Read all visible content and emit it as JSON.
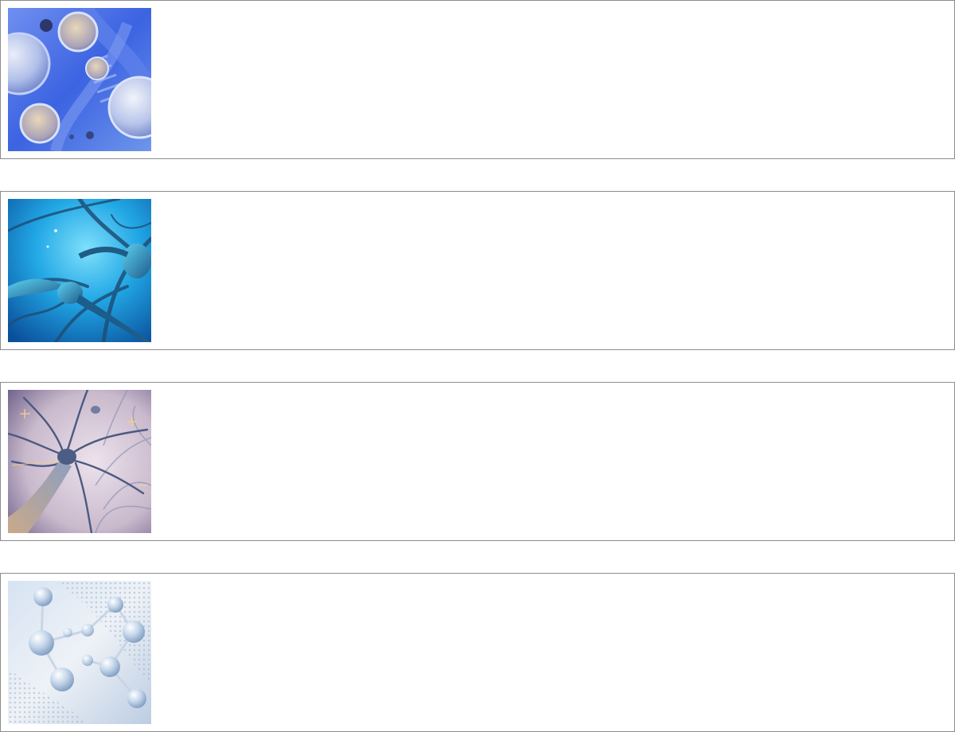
{
  "cards": [
    {
      "thumbnail": "stem-cells-dna-image",
      "accent": "#3f6ee0"
    },
    {
      "thumbnail": "neurons-blue-image",
      "accent": "#1f8fd6"
    },
    {
      "thumbnail": "neuron-network-image",
      "accent": "#8a7fb0"
    },
    {
      "thumbnail": "molecule-structure-image",
      "accent": "#a9c3de"
    }
  ],
  "colors": {
    "card_border": "#8c8c8c",
    "background": "#ffffff"
  }
}
